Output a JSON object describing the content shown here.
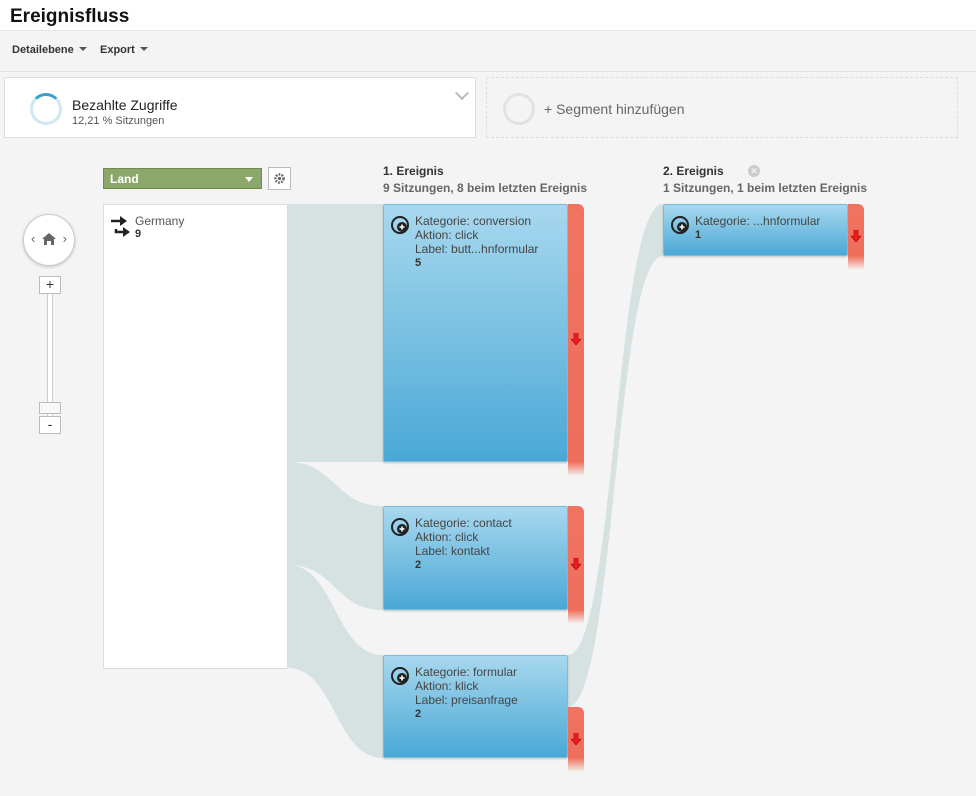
{
  "header": {
    "title": "Ereignisfluss"
  },
  "toolbar": {
    "detail_label": "Detailebene",
    "export_label": "Export"
  },
  "segments": {
    "active": {
      "name": "Bezahlte Zugriffe",
      "share": "12,21 % Sitzungen"
    },
    "add_label": "+ Segment hinzufügen"
  },
  "dimension": {
    "selected": "Land"
  },
  "nav": {
    "left": "‹",
    "right": "›",
    "zoom_in": "+",
    "zoom_out": "-"
  },
  "countries": [
    {
      "name": "Germany",
      "count": "9"
    }
  ],
  "columns": [
    {
      "title": "1. Ereignis",
      "subtitle": "9 Sitzungen, 8 beim letzten Ereignis",
      "nodes": [
        {
          "kategorie": "Kategorie: conversion",
          "aktion": "Aktion: click",
          "label": "Label: butt...hnformular",
          "count": "5"
        },
        {
          "kategorie": "Kategorie: contact",
          "aktion": "Aktion: click",
          "label": "Label: kontakt",
          "count": "2"
        },
        {
          "kategorie": "Kategorie: formular",
          "aktion": "Aktion: klick",
          "label": "Label: preisanfrage",
          "count": "2"
        }
      ]
    },
    {
      "title": "2. Ereignis",
      "subtitle": "1 Sitzungen, 1 beim letzten Ereignis",
      "nodes": [
        {
          "kategorie": "Kategorie: ...hnformular",
          "count": "1"
        }
      ]
    }
  ],
  "colors": {
    "node_top": "#a8d8ee",
    "node_bottom": "#4aa8d6",
    "dropoff": "#ef6f5d",
    "flow": "#d6e2e2",
    "dimension": "#8ca76a"
  }
}
